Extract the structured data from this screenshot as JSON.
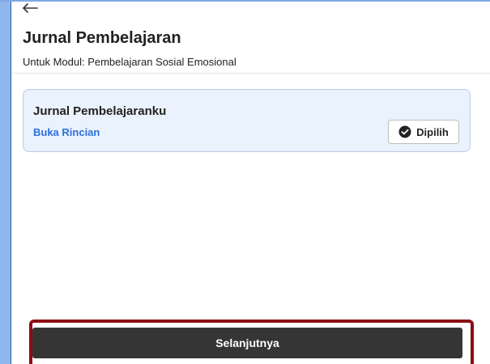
{
  "header": {
    "back_icon": "arrow-left-icon",
    "title": "Jurnal Pembelajaran",
    "subtitle": "Untuk Modul: Pembelajaran Sosial Emosional"
  },
  "card": {
    "title": "Jurnal Pembelajaranku",
    "link_label": "Buka Rincian",
    "selected_label": "Dipilih",
    "selected_icon": "check-circle-icon",
    "link_color": "#2d6fdb",
    "card_background": "#eaf2fd"
  },
  "footer": {
    "next_label": "Selanjutnya",
    "next_button_color": "#353535",
    "highlight_color": "#8a0f14"
  }
}
